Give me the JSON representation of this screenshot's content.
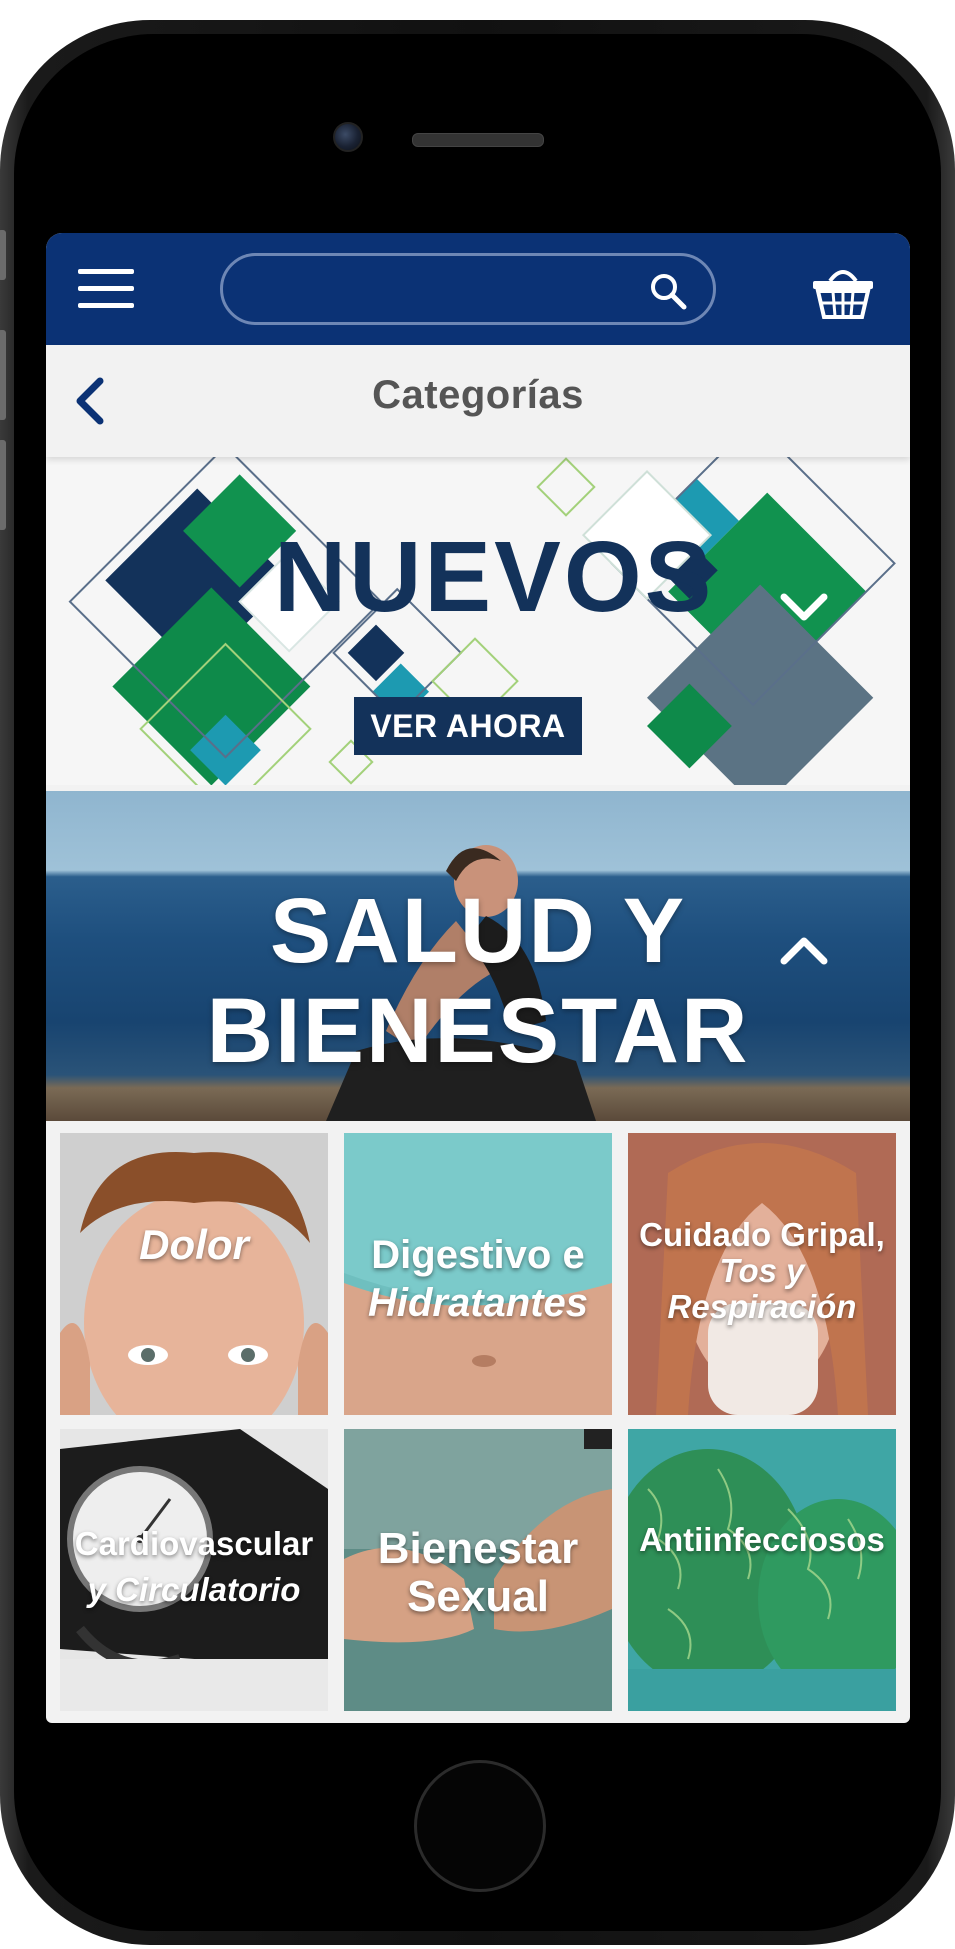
{
  "header": {
    "search_placeholder": "",
    "page_title": "Categorías"
  },
  "promo": {
    "title": "NUEVOS",
    "cta_label": "VER AHORA"
  },
  "category_banner": {
    "title_line1": "SALUD Y",
    "title_line2": "BIENESTAR"
  },
  "categories": [
    {
      "label_line1": "Dolor",
      "label_line2": ""
    },
    {
      "label_line1": "Digestivo e",
      "label_line2": "Hidratantes"
    },
    {
      "label_line1": "Cuidado Gripal,",
      "label_line2": "Tos y",
      "label_line3": "Respiración"
    },
    {
      "label_line1": "Cardiovascular",
      "label_line2": "y Circulatorio"
    },
    {
      "label_line1": "Bienestar",
      "label_line2": "Sexual"
    },
    {
      "label_line1": "Antiinfecciosos",
      "label_line2": ""
    }
  ],
  "colors": {
    "brand_navy": "#0b3275",
    "promo_navy": "#13325a",
    "promo_green": "#0e8a4a",
    "promo_teal": "#1d9ab1",
    "title_bar_bg": "#f2f2f2"
  },
  "icons": [
    "menu-icon",
    "search-icon",
    "basket-icon",
    "chevron-left-icon",
    "chevron-down-icon",
    "chevron-up-icon"
  ]
}
